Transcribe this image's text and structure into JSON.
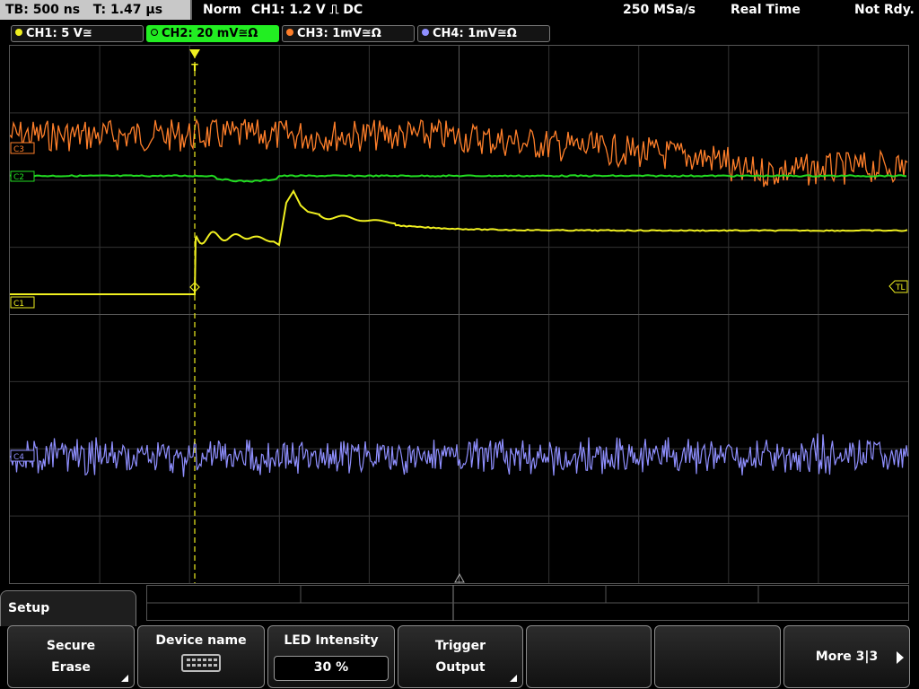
{
  "header": {
    "timebase": "TB: 500 ns",
    "trigger_time": "T: 1.47 µs",
    "mode": "Norm",
    "trigger_info": "CH1: 1.2 V ⎍ DC",
    "sample_rate": "250 MSa/s",
    "acq_mode": "Real Time",
    "status": "Not Rdy."
  },
  "channels": [
    {
      "label": "CH1: 5 V≅",
      "color": "#f0f020",
      "active": false
    },
    {
      "label": "CH2: 20 mV≅Ω",
      "color": "#22dd22",
      "active": true
    },
    {
      "label": "CH3: 1mV≅Ω",
      "color": "#ff7f2a",
      "active": false
    },
    {
      "label": "CH4: 1mV≅Ω",
      "color": "#8f8fff",
      "active": false
    }
  ],
  "markers": {
    "c3": "C3",
    "c2": "C2",
    "c1": "C1",
    "c4": "C4",
    "trigger_level": "TL",
    "trigger_pos": "T"
  },
  "menu": {
    "setup_label": "Setup",
    "softkeys": {
      "secure_erase": {
        "line1": "Secure",
        "line2": "Erase"
      },
      "device_name": {
        "line1": "Device name"
      },
      "led_intensity": {
        "line1": "LED Intensity",
        "value": "30 %"
      },
      "trigger_output": {
        "line1": "Trigger",
        "line2": "Output"
      },
      "more": {
        "line1": "More 3|3"
      }
    }
  }
}
